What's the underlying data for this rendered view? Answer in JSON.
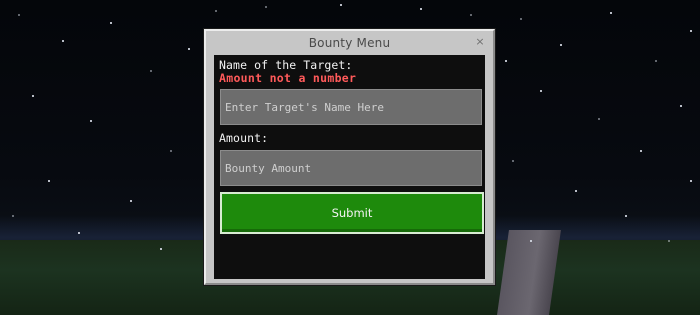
{
  "dialog": {
    "title": "Bounty Menu",
    "close_icon": "close-icon",
    "close_glyph": "×"
  },
  "form": {
    "target_label": "Name of the Target:",
    "error_message": "Amount not a number",
    "target_input": {
      "placeholder": "Enter Target's Name Here",
      "value": ""
    },
    "amount_label": "Amount:",
    "amount_input": {
      "placeholder": "Bounty Amount",
      "value": ""
    },
    "submit_label": "Submit"
  },
  "colors": {
    "error": "#ff5a5a",
    "submit_button": "#1e8a0c",
    "panel_background": "#0e0e0e",
    "dialog_frame": "#c6c6c6",
    "input_background": "#6d6d6d"
  }
}
